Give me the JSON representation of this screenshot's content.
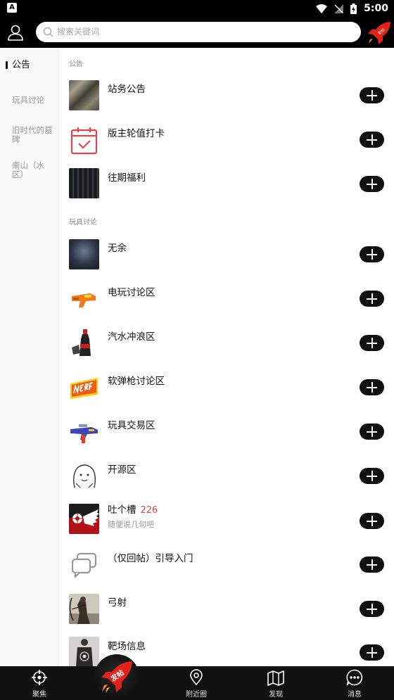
{
  "status_bar": {
    "time": "5:00",
    "app_badge": "A"
  },
  "header": {
    "search_placeholder": "搜索关键词",
    "rocket_badge": "发帖"
  },
  "sidebar": {
    "items": [
      {
        "label": "公告",
        "active": true
      },
      {
        "label": "玩具讨论",
        "active": false
      },
      {
        "label": "旧时代的墓碑",
        "active": false
      },
      {
        "label": "南山（水区）",
        "active": false
      }
    ]
  },
  "sections": [
    {
      "title": "公告",
      "forums": [
        {
          "name": "站务公告",
          "thumb": "camo-photo"
        },
        {
          "name": "版主轮值打卡",
          "thumb": "calendar-check-icon"
        },
        {
          "name": "往期福利",
          "thumb": "dark-shelf-photo"
        }
      ]
    },
    {
      "title": "玩具讨论",
      "forums": [
        {
          "name": "无余",
          "thumb": "armored-figure-photo"
        },
        {
          "name": "电玩讨论区",
          "thumb": "orange-blaster-photo"
        },
        {
          "name": "汽水冲浪区",
          "thumb": "soda-bottle-photo"
        },
        {
          "name": "软弹枪讨论区",
          "thumb": "nerf-logo"
        },
        {
          "name": "玩具交易区",
          "thumb": "blue-blaster-photo"
        },
        {
          "name": "开源区",
          "thumb": "cartoon-sketch"
        },
        {
          "name": "吐个槽",
          "count": "226",
          "subtitle": "随便说几句吧",
          "thumb": "winged-target-logo"
        },
        {
          "name": "（仅回帖）引导入门",
          "thumb": "chat-bubbles-icon"
        },
        {
          "name": "弓射",
          "thumb": "archer-photo"
        },
        {
          "name": "靶场信息",
          "thumb": "target-vest-photo"
        }
      ]
    }
  ],
  "tabbar": {
    "items": [
      {
        "label": "聚焦",
        "icon": "crosshair-icon"
      },
      {
        "label": "发帖",
        "icon": "rocket-icon"
      },
      {
        "label": "附近圈",
        "icon": "location-pin-icon"
      },
      {
        "label": "发现",
        "icon": "map-icon"
      },
      {
        "label": "消息",
        "icon": "message-icon"
      }
    ]
  },
  "colors": {
    "accent": "#e0474d",
    "bar": "#111111",
    "rocket": "#e2231a"
  }
}
